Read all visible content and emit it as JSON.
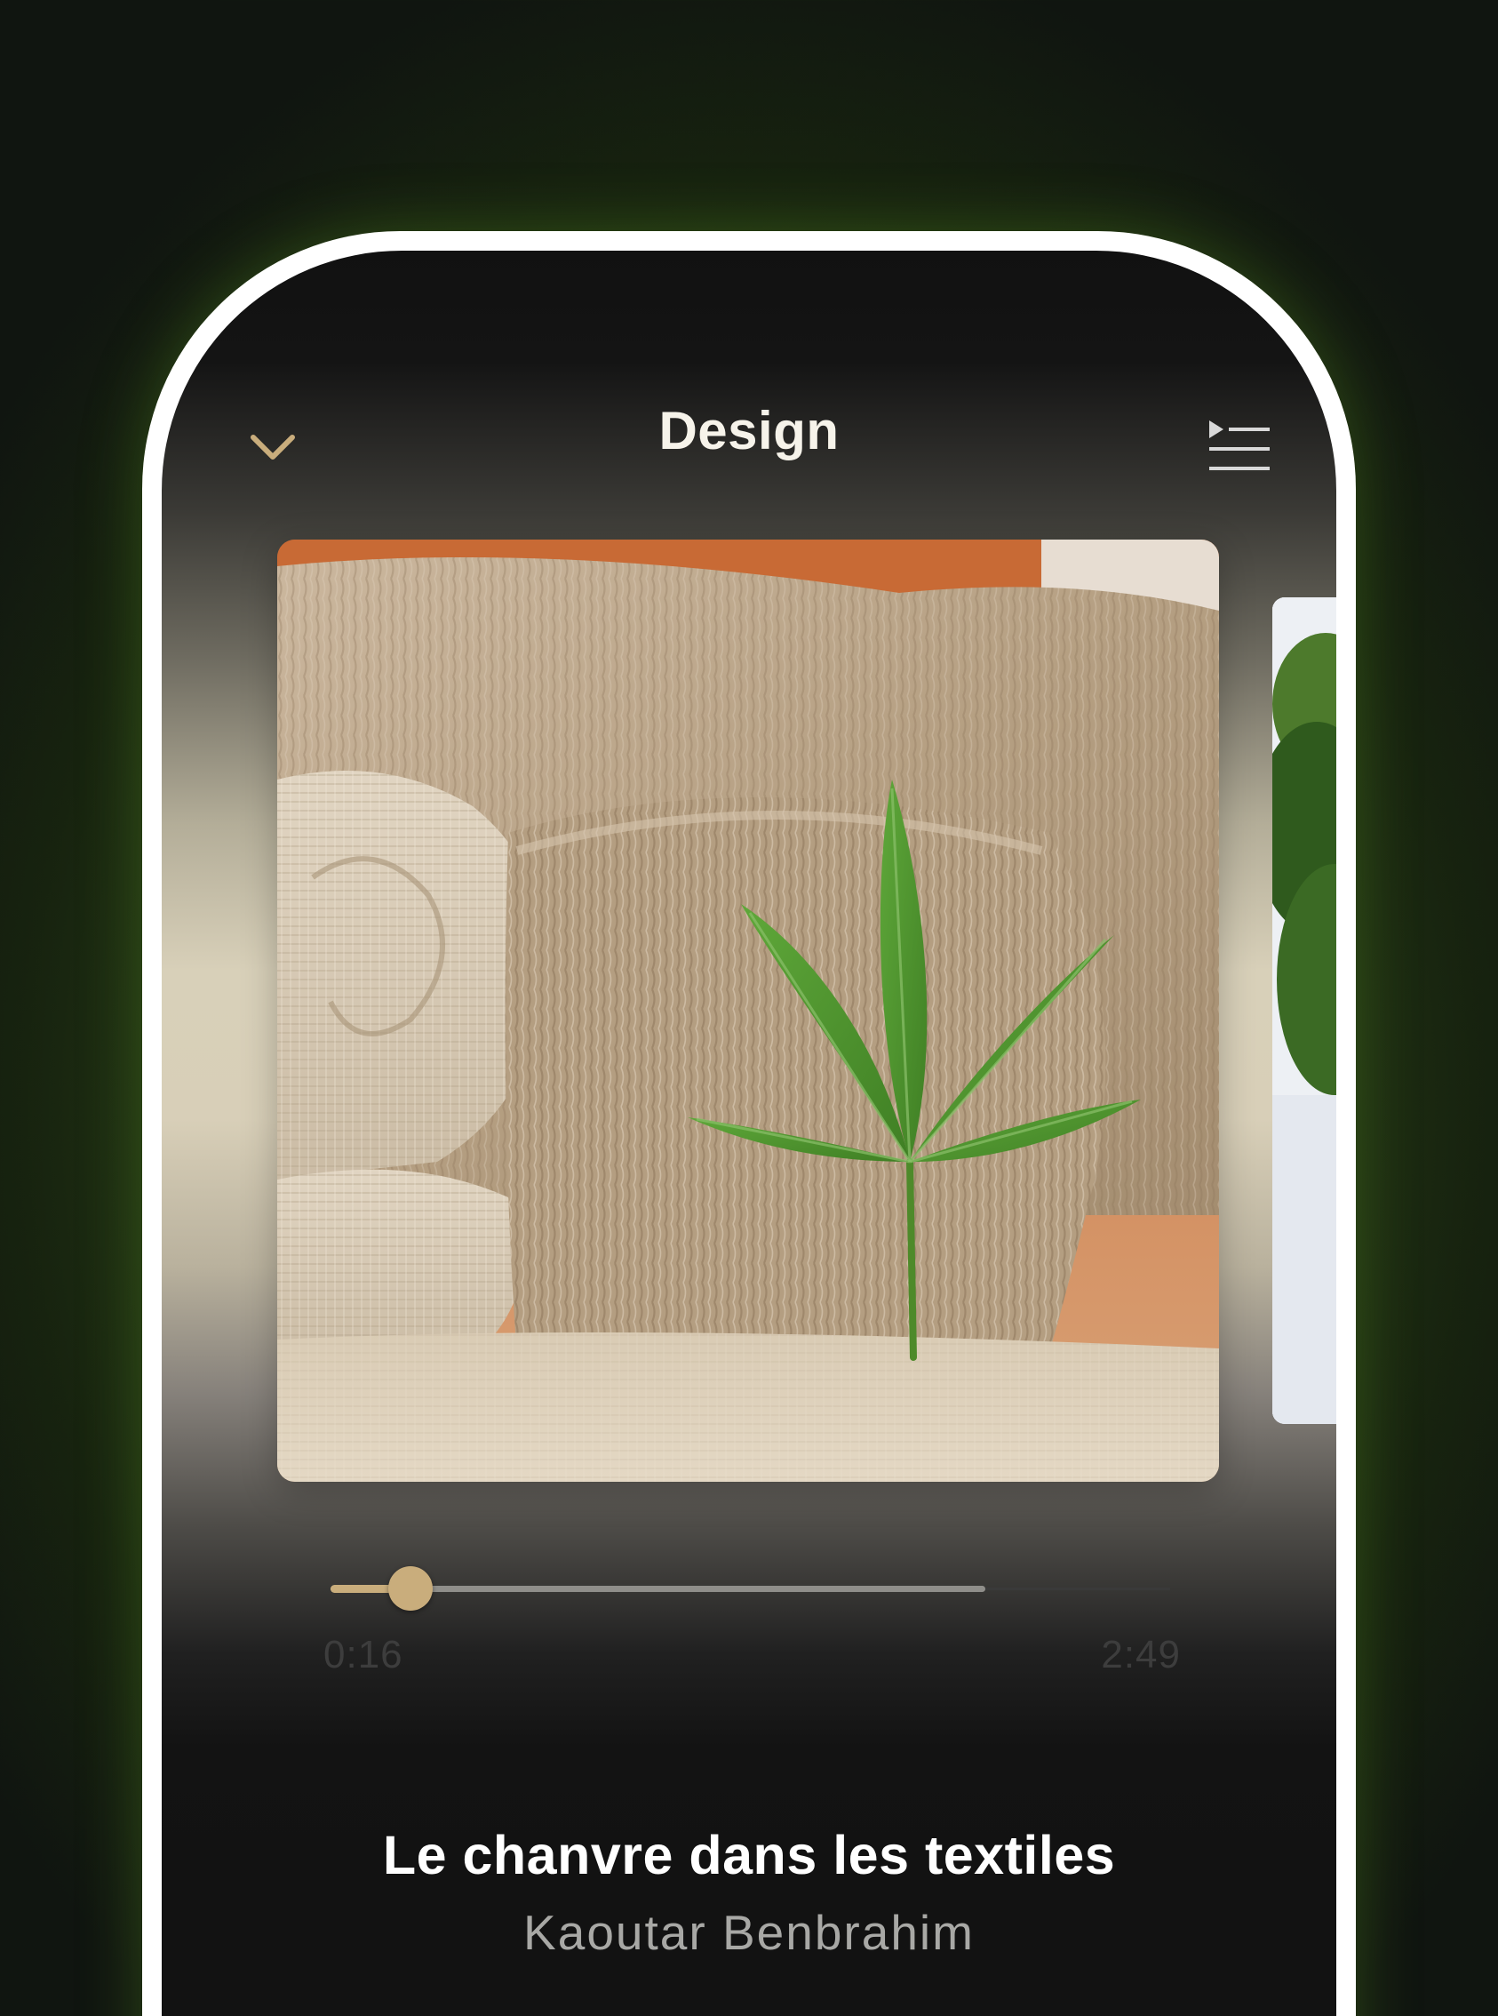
{
  "header": {
    "title": "Design",
    "collapse_icon": "chevron-down-icon",
    "queue_icon": "play-queue-icon"
  },
  "player": {
    "elapsed": "0:16",
    "total": "2:49",
    "progress_fraction": 0.095,
    "buffer_fraction": 0.78
  },
  "track": {
    "title": "Le chanvre dans les textiles",
    "artist": "Kaoutar Benbrahim"
  },
  "colors": {
    "accent": "#c9ad7c",
    "background": "#111111",
    "outer_glow": "#3c5a1f"
  }
}
